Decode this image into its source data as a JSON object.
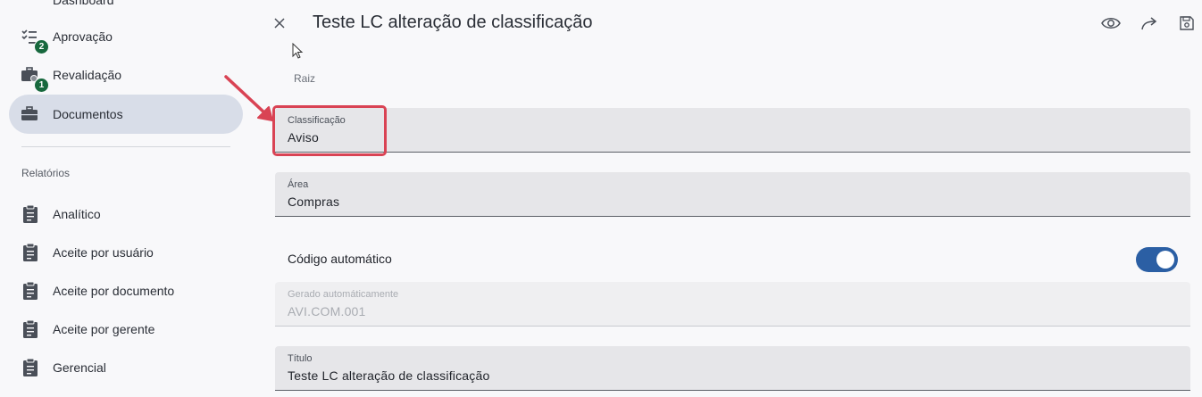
{
  "sidebar": {
    "items": [
      {
        "label": "Dashboard",
        "icon": "dashboard-icon"
      },
      {
        "label": "Aprovação",
        "icon": "checklist-icon",
        "badge": "2"
      },
      {
        "label": "Revalidação",
        "icon": "briefcase-clock-icon",
        "badge": "1"
      },
      {
        "label": "Documentos",
        "icon": "briefcase-icon",
        "active": true
      }
    ],
    "reports_title": "Relatórios",
    "reports": [
      {
        "label": "Analítico"
      },
      {
        "label": "Aceite por usuário"
      },
      {
        "label": "Aceite por documento"
      },
      {
        "label": "Aceite por gerente"
      },
      {
        "label": "Gerencial"
      }
    ]
  },
  "panel": {
    "title": "Teste LC alteração de classificação",
    "breadcrumb": "Raiz",
    "icons": [
      "close-icon",
      "eye-icon",
      "share-icon",
      "save-icon"
    ],
    "fields": {
      "classificacao": {
        "label": "Classificação",
        "value": "Aviso"
      },
      "area": {
        "label": "Área",
        "value": "Compras"
      },
      "codigo": {
        "label": "Gerado automáticamente",
        "value": "AVI.COM.001"
      },
      "titulo": {
        "label": "Título",
        "value": "Teste LC alteração de classificação"
      }
    },
    "toggle": {
      "label": "Código automático",
      "on": true
    }
  },
  "colors": {
    "accent": "#2b5fa4",
    "badge": "#17683d",
    "highlight": "#d94354",
    "active_nav": "#d8dde8"
  }
}
